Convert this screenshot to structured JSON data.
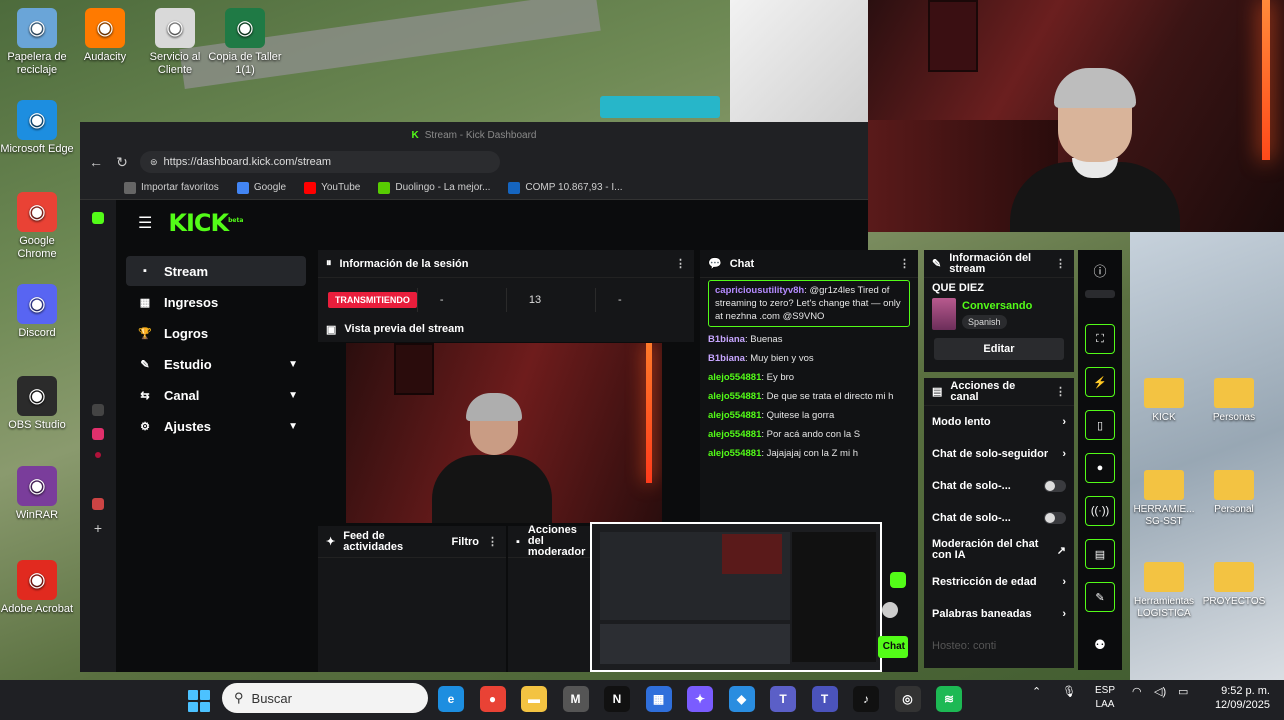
{
  "desktop": {
    "icons_left": [
      {
        "label": "Papelera de reciclaje",
        "icon": "recycle-bin-icon",
        "color": "#6aa5d8"
      },
      {
        "label": "Microsoft Edge",
        "icon": "edge-icon",
        "color": "#1d8ee0"
      },
      {
        "label": "Google Chrome",
        "icon": "chrome-icon",
        "color": "#e94235"
      },
      {
        "label": "Discord",
        "icon": "discord-icon",
        "color": "#5865f2"
      },
      {
        "label": "OBS Studio",
        "icon": "obs-icon",
        "color": "#2b2b2b"
      },
      {
        "label": "WinRAR",
        "icon": "winrar-icon",
        "color": "#7a3d9b"
      },
      {
        "label": "Adobe Acrobat",
        "icon": "acrobat-icon",
        "color": "#e12a1f"
      }
    ],
    "icons_top": [
      {
        "label": "Audacity",
        "icon": "audacity-icon",
        "color": "#ff7a00"
      },
      {
        "label": "Servicio al Cliente",
        "icon": "document-icon",
        "color": "#d9d9d9"
      },
      {
        "label": "Copia de Taller 1(1)",
        "icon": "excel-icon",
        "color": "#1f7a45"
      }
    ],
    "folders_right": [
      {
        "label": "KICK"
      },
      {
        "label": "Personas"
      },
      {
        "label": "HERRAMIE... SG-SST"
      },
      {
        "label": "Personal"
      },
      {
        "label": "Herramientas LOGISTICA"
      },
      {
        "label": "PROYECTOS"
      }
    ]
  },
  "browser": {
    "title": "Stream - Kick Dashboard",
    "url": "https://dashboard.kick.com/stream",
    "bookmarks": [
      {
        "label": "Importar favoritos",
        "color": "#666"
      },
      {
        "label": "Google",
        "color": "#4285f4"
      },
      {
        "label": "YouTube",
        "color": "#ff0000"
      },
      {
        "label": "Duolingo - La mejor...",
        "color": "#58cc02"
      },
      {
        "label": "COMP 10.867,93 - I...",
        "color": "#1565c0"
      }
    ]
  },
  "kick": {
    "logo": "KICK",
    "logo_badge": "beta",
    "nav": [
      {
        "label": "Stream",
        "icon": "stream-icon",
        "active": true,
        "expandable": false
      },
      {
        "label": "Ingresos",
        "icon": "revenue-icon",
        "active": false,
        "expandable": false
      },
      {
        "label": "Logros",
        "icon": "trophy-icon",
        "active": false,
        "expandable": false
      },
      {
        "label": "Estudio",
        "icon": "studio-icon",
        "active": false,
        "expandable": true
      },
      {
        "label": "Canal",
        "icon": "channel-icon",
        "active": false,
        "expandable": true
      },
      {
        "label": "Ajustes",
        "icon": "settings-icon",
        "active": false,
        "expandable": true
      }
    ],
    "session": {
      "title": "Información de la sesión",
      "status": "TRANSMITIENDO",
      "stats": [
        "-",
        "13",
        "-"
      ]
    },
    "preview": {
      "title": "Vista previa del stream"
    },
    "feed": {
      "title": "Feed de actividades",
      "filter": "Filtro"
    },
    "mod": {
      "title": "Acciones del moderador"
    },
    "chat": {
      "title": "Chat",
      "pinned": {
        "user": "capriciousutilityv8h",
        "text": ": @gr1z4les Tired of streaming to zero? Let's change that — only at nezhna .com @S9VNO"
      },
      "messages": [
        {
          "user": "B1biana",
          "text": ": Buenas",
          "color": "purple"
        },
        {
          "user": "B1biana",
          "text": ": Muy bien y vos",
          "color": "purple"
        },
        {
          "user": "alejo554881",
          "text": ": Ey bro",
          "color": "green"
        },
        {
          "user": "alejo554881",
          "text": ": De que se trata el directo mi h",
          "color": "green"
        },
        {
          "user": "alejo554881",
          "text": ": Quitese la gorra",
          "color": "green"
        },
        {
          "user": "alejo554881",
          "text": ": Por acá ando con la S",
          "color": "green"
        },
        {
          "user": "alejo554881",
          "text": ": Jajajajaj con la Z mi h",
          "color": "green"
        }
      ],
      "send_label": "Chat"
    },
    "stream_info": {
      "title": "Información del stream",
      "stream_title": "QUE DIEZ",
      "category": "Conversando",
      "language": "Spanish",
      "edit": "Editar"
    },
    "channel_actions": {
      "title": "Acciones de canal",
      "items": [
        {
          "label": "Modo lento",
          "control": "chevron"
        },
        {
          "label": "Chat de solo-seguidor",
          "control": "chevron"
        },
        {
          "label": "Chat de solo-...",
          "control": "toggle"
        },
        {
          "label": "Chat de solo-...",
          "control": "toggle"
        },
        {
          "label": "Moderación del chat con IA",
          "control": "external"
        },
        {
          "label": "Restricción de edad",
          "control": "chevron"
        },
        {
          "label": "Palabras baneadas",
          "control": "chevron"
        },
        {
          "label": "Hosteo: conti",
          "control": "none"
        }
      ]
    },
    "rail": [
      "info-icon",
      "expand-icon",
      "lightning-icon",
      "clipboard-icon",
      "chat-bubble-icon",
      "broadcast-icon",
      "layout-icon",
      "wrench-icon",
      "people-icon"
    ]
  },
  "taskbar": {
    "search_placeholder": "Buscar",
    "lang": "ESP",
    "lang2": "LAA",
    "time": "9:52 p. m.",
    "date": "12/09/2025",
    "apps": [
      {
        "icon": "edge-icon",
        "color": "#1d8ee0",
        "glyph": "e"
      },
      {
        "icon": "chrome-icon",
        "color": "#e94235",
        "glyph": "●"
      },
      {
        "icon": "file-explorer-icon",
        "color": "#f3c342",
        "glyph": "▬"
      },
      {
        "icon": "app-m-icon",
        "color": "#555",
        "glyph": "M"
      },
      {
        "icon": "netflix-icon",
        "color": "#111",
        "glyph": "N"
      },
      {
        "icon": "store-icon",
        "color": "#2f6fdb",
        "glyph": "▦"
      },
      {
        "icon": "copilot-icon",
        "color": "#7a5cff",
        "glyph": "✦"
      },
      {
        "icon": "paint-icon",
        "color": "#2a8de0",
        "glyph": "◆"
      },
      {
        "icon": "teams-icon",
        "color": "#5b5fc7",
        "glyph": "T"
      },
      {
        "icon": "teams-badge-icon",
        "color": "#4b53bc",
        "glyph": "T"
      },
      {
        "icon": "tiktok-icon",
        "color": "#111",
        "glyph": "♪"
      },
      {
        "icon": "obs-icon",
        "color": "#333",
        "glyph": "◎"
      },
      {
        "icon": "spotify-icon",
        "color": "#1db954",
        "glyph": "≋"
      }
    ]
  }
}
